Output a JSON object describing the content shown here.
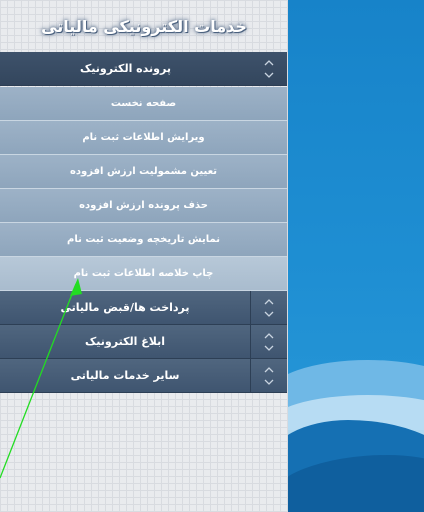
{
  "header": {
    "title": "خدمات الکترونیکی مالیاتی"
  },
  "sections": {
    "electronic_file": {
      "label": "پرونده الکترونیک"
    },
    "payments": {
      "label": "پرداخت ها/قبض مالیاتی"
    },
    "notification": {
      "label": "ابلاغ الکترونیک"
    },
    "other_services": {
      "label": "سایر خدمات مالیاتی"
    }
  },
  "submenu": {
    "items": [
      {
        "label": "صفحه نخست"
      },
      {
        "label": "ویرایش اطلاعات ثبت نام"
      },
      {
        "label": "تعیین مشمولیت ارزش افزوده"
      },
      {
        "label": "حذف پرونده ارزش افزوده"
      },
      {
        "label": "نمایش تاریخچه وضعیت ثبت نام"
      },
      {
        "label": "چاپ خلاصه اطلاعات ثبت نام"
      }
    ]
  },
  "colors": {
    "section_bg": "#46607a",
    "submenu_bg": "#97acc2",
    "panel_blue": "#1a86cc",
    "cursor_green": "#22dd22"
  },
  "icons": {
    "toggle": "up-down-chevron-icon"
  }
}
